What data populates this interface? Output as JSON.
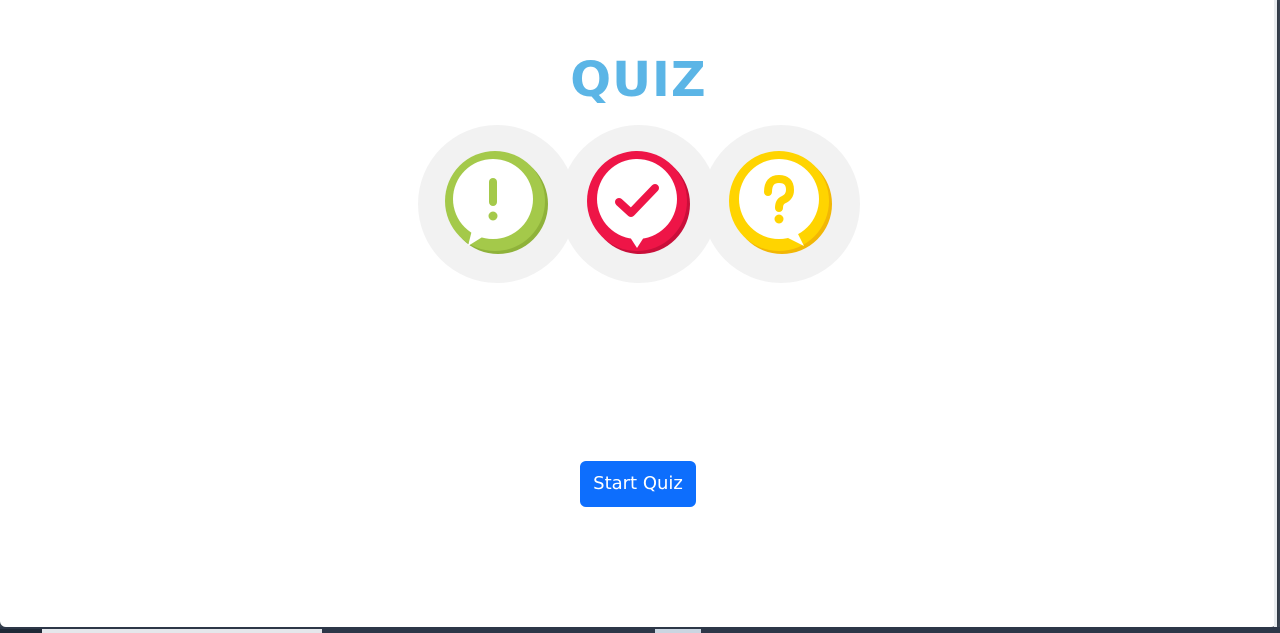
{
  "quiz": {
    "title": "QUIZ",
    "icons": [
      {
        "name": "exclamation-icon",
        "color": "#a4c94a",
        "ring": "#8fb23a"
      },
      {
        "name": "checkmark-icon",
        "color": "#ee1547",
        "ring": "#c90f3a"
      },
      {
        "name": "question-icon",
        "color": "#ffd400",
        "ring": "#f2b705"
      }
    ],
    "start_button_label": "Start Quiz",
    "accent_color": "#5bb5e6",
    "button_color": "#0d6efd"
  }
}
